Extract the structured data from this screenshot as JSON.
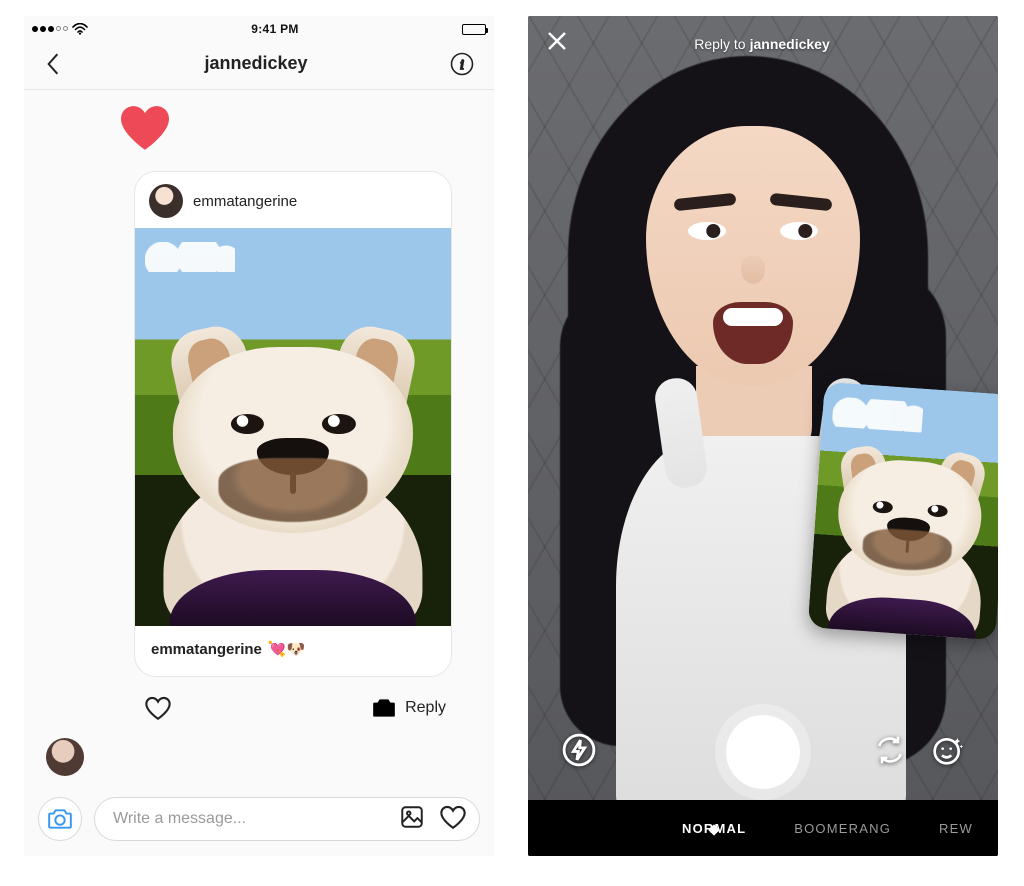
{
  "status_bar": {
    "time": "9:41 PM"
  },
  "dm": {
    "username": "jannedickey",
    "post": {
      "author": "emmatangerine",
      "caption_user": "emmatangerine",
      "caption_emoji": "💘🐶"
    },
    "actions": {
      "reply_label": "Reply"
    },
    "composer": {
      "placeholder": "Write a message..."
    }
  },
  "camera": {
    "title_prefix": "Reply to",
    "title_user": "jannedickey",
    "modes": {
      "normal": "NORMAL",
      "boomerang": "BOOMERANG",
      "rewind_partial": "REW"
    }
  }
}
